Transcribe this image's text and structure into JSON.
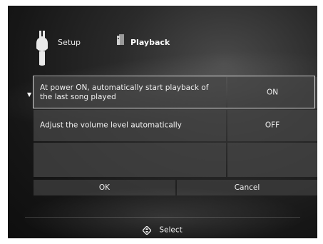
{
  "header": {
    "setup_label": "Setup",
    "playback_label": "Playback",
    "setup_icon": "wrench-icon",
    "playback_icon": "music-note-icon"
  },
  "settings": {
    "rows": [
      {
        "label": "At power ON, automatically start playback of the last song played",
        "value": "ON",
        "selected": true
      },
      {
        "label": "Adjust the volume level automatically",
        "value": "OFF",
        "selected": false
      },
      {
        "label": "",
        "value": "",
        "selected": false
      }
    ]
  },
  "buttons": {
    "ok_label": "OK",
    "cancel_label": "Cancel"
  },
  "footer": {
    "select_label": "Select",
    "select_icon": "directional-pad-icon"
  },
  "colors": {
    "background": "#161616",
    "cell": "#464646",
    "text": "#f0f0f0",
    "selection_frame": "#d8d8d8"
  }
}
